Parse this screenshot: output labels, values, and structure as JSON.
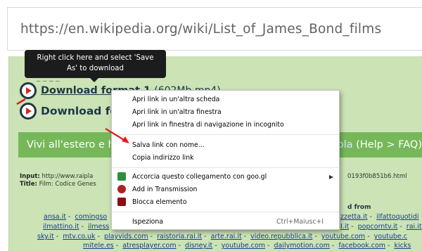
{
  "url": "https://en.wikipedia.org/wiki/List_of_James_Bond_films",
  "tooltip": {
    "line1": "Right click here and select 'Save",
    "line2": "As' to download"
  },
  "downloads": [
    {
      "label": "Download format 1",
      "size": "(602Mb  mp4)"
    },
    {
      "label": "Download fo"
    }
  ],
  "banner": {
    "left": "Vivi all'estero e h",
    "right_kw": "pla",
    "right": "(Help > FAQ)"
  },
  "meta": {
    "input_label": "Input:",
    "input_value": "http://www.raipla",
    "title_label": "Title:",
    "title_value": "Film: Codice Genes",
    "right_value": "0193f0b851b6.html",
    "found_from": "d from"
  },
  "links": {
    "row1": [
      "ansa.it",
      "comingso",
      "zzetta.it",
      "ilfattoquotidi"
    ],
    "row2": [
      "ilmattino.it",
      "ilmess",
      "I.it",
      "popcorntv.it",
      "rai.it"
    ],
    "row3": [
      "sky.it",
      "mtv.co.uk",
      "playvids.com",
      "raistoria.rai.it",
      "arte.rai.it",
      "video.repubblica.it",
      "youtube.com",
      "youtube.c"
    ],
    "row4": [
      "mitele.es",
      "atresplayer.com",
      "disney.it",
      "youtube.com",
      "dailymotion.com",
      "facebook.com",
      "kicks"
    ]
  },
  "context_menu": {
    "items": [
      {
        "label": "Apri link in un'altra scheda"
      },
      {
        "label": "Apri link in un'altra finestra"
      },
      {
        "label": "Apri link in finestra di navigazione in incognito"
      },
      {
        "label": "Salva link con nome..."
      },
      {
        "label": "Copia indirizzo link"
      },
      {
        "label": "Accorcia questo collegamento con goo.gl",
        "icon": "goo-gl-icon",
        "has_submenu": true
      },
      {
        "label": "Add in Transmission",
        "icon": "transmission-icon"
      },
      {
        "label": "Blocca elemento",
        "icon": "ublock-icon"
      },
      {
        "label": "Ispeziona",
        "shortcut": "Ctrl+Maiusc+I"
      }
    ],
    "submenu_glyph": "▶"
  },
  "colors": {
    "page_bg": "#cbe3b5",
    "banner": "#76b859",
    "arrow": "#e02020",
    "dark": "#1f3848"
  }
}
